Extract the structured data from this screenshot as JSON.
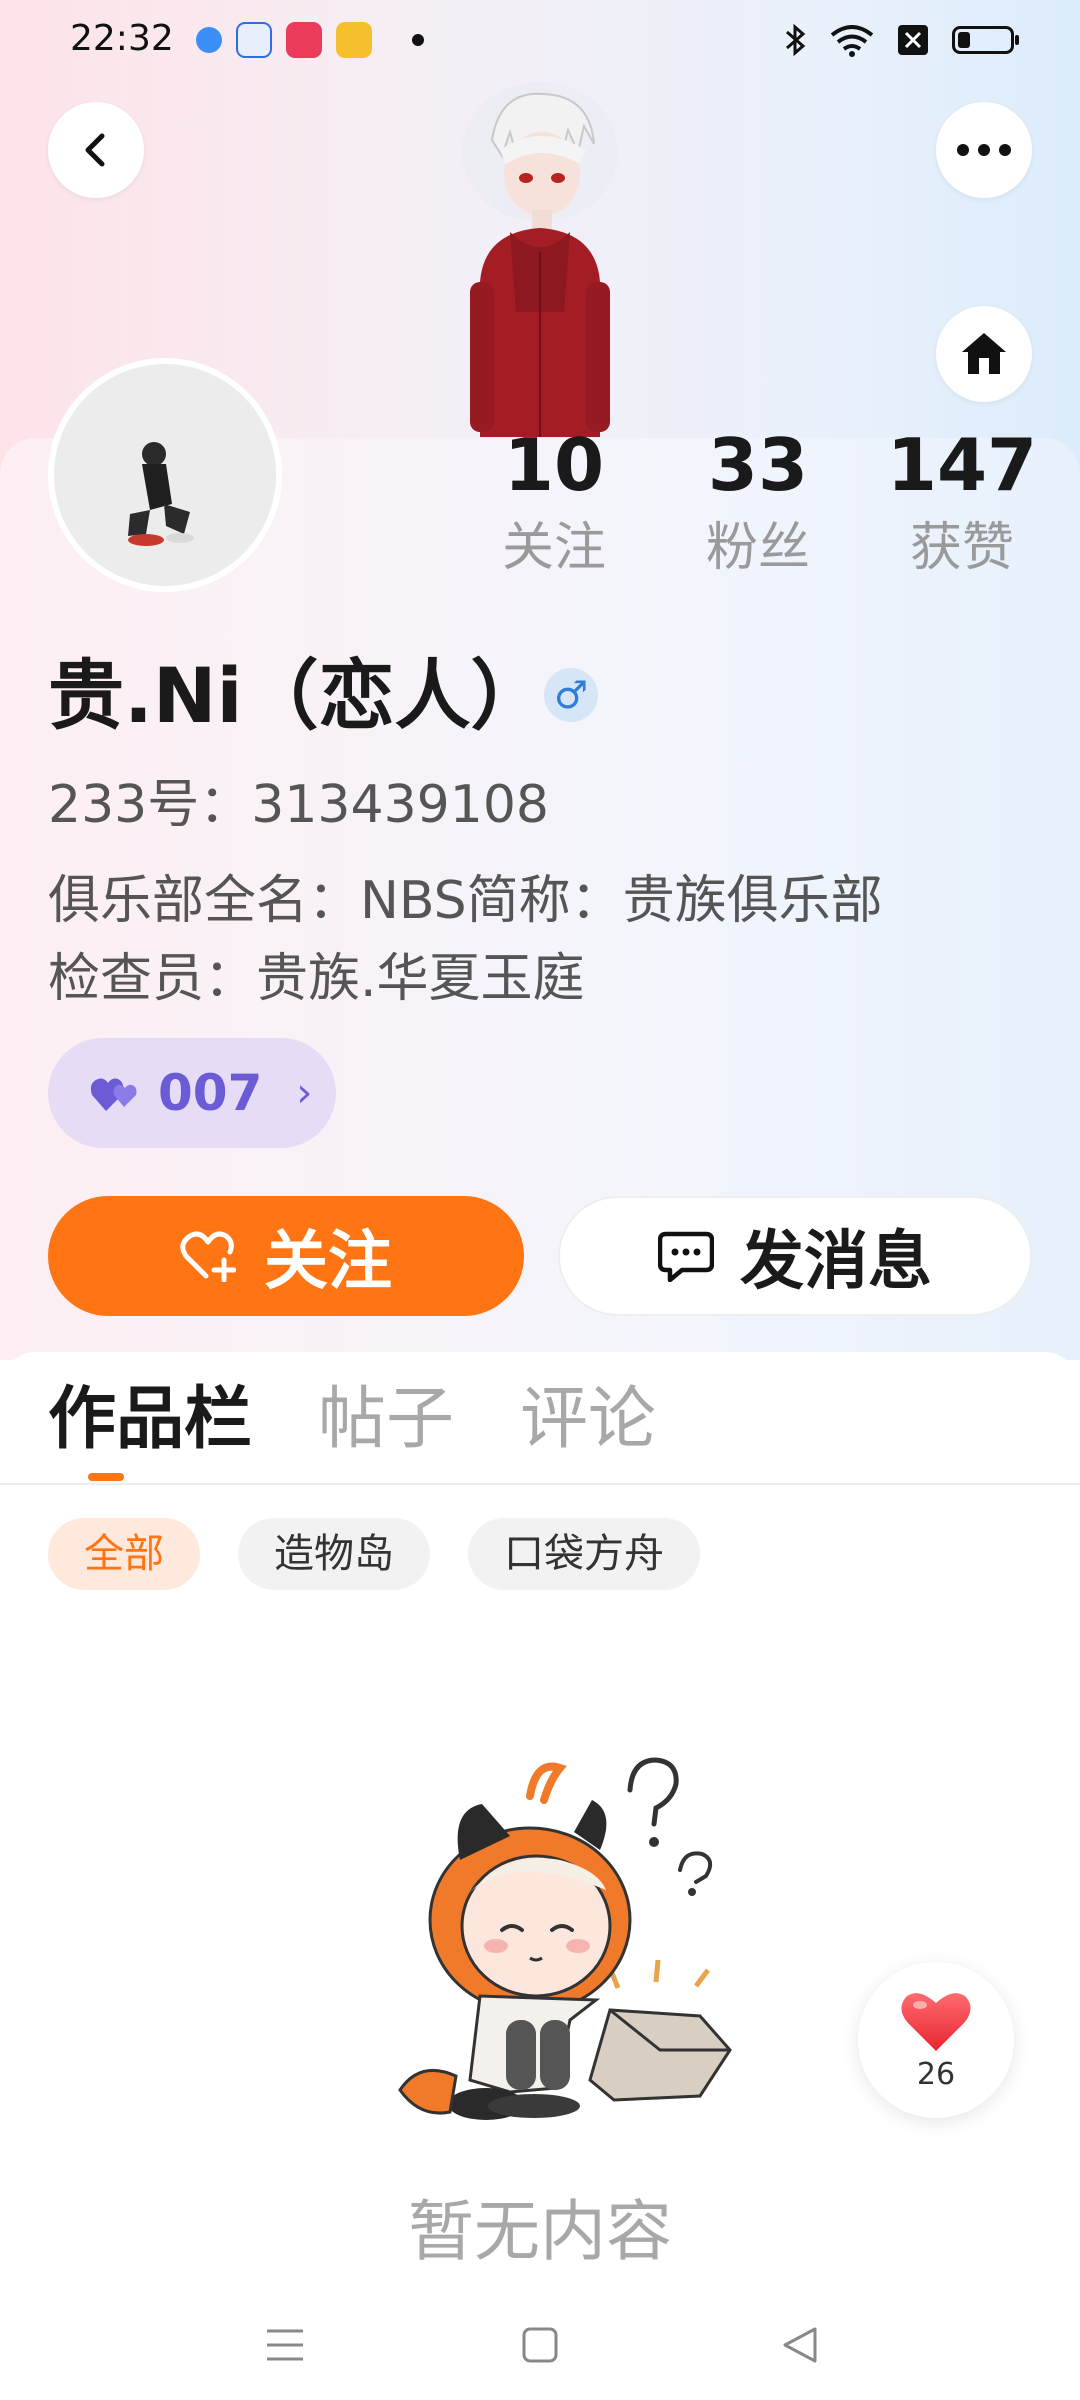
{
  "status_bar": {
    "time": "22:32"
  },
  "header": {
    "back_icon": "chevron-left-icon",
    "more_icon": "more-dots-icon",
    "home_icon": "home-icon"
  },
  "stats": [
    {
      "value": "10",
      "label": "关注"
    },
    {
      "value": "33",
      "label": "粉丝"
    },
    {
      "value": "147",
      "label": "获赞"
    }
  ],
  "profile": {
    "username": "贵.Ni（恋人）",
    "gender_symbol": "♂",
    "user_id": "233号：313439108",
    "bio_lines": [
      "俱乐部全名：NBS简称：贵族俱乐部",
      "检查员：贵族.华夏玉庭"
    ],
    "level": "007"
  },
  "actions": {
    "follow_label": "关注",
    "message_label": "发消息"
  },
  "tabs": [
    {
      "label": "作品栏",
      "active": true
    },
    {
      "label": "帖子",
      "active": false
    },
    {
      "label": "评论",
      "active": false
    }
  ],
  "filters": [
    {
      "label": "全部",
      "active": true
    },
    {
      "label": "造物岛",
      "active": false
    },
    {
      "label": "口袋方舟",
      "active": false
    }
  ],
  "empty_state": {
    "text": "暂无内容"
  },
  "like_button": {
    "count": "26"
  },
  "colors": {
    "accent": "#ff7413",
    "level": "#6b5cd6"
  }
}
